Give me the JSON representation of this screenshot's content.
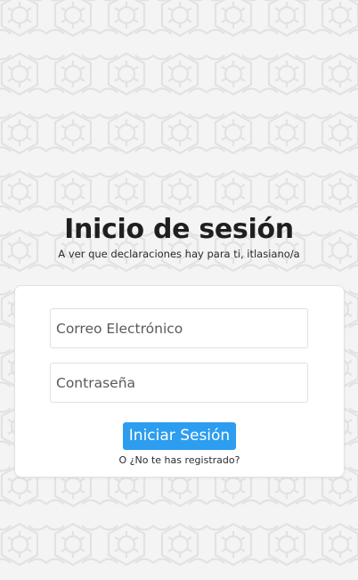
{
  "page": {
    "title": "Inicio de sesión",
    "subtitle": "A ver que declaraciones hay para ti, itlasiano/a"
  },
  "form": {
    "email_placeholder": "Correo Electrónico",
    "email_value": "",
    "password_placeholder": "Contraseña",
    "password_value": "",
    "submit_label": "Iniciar Sesión",
    "register_link": "O ¿No te has registrado?"
  },
  "colors": {
    "background": "#f4f4f4",
    "pattern": "#e3e3e3",
    "card": "#ffffff",
    "primary_button": "#2d9df0",
    "title_text": "#1f1f1f"
  },
  "icons": {
    "background_pattern": "decorative-hexagon-flower-pattern-icon"
  }
}
